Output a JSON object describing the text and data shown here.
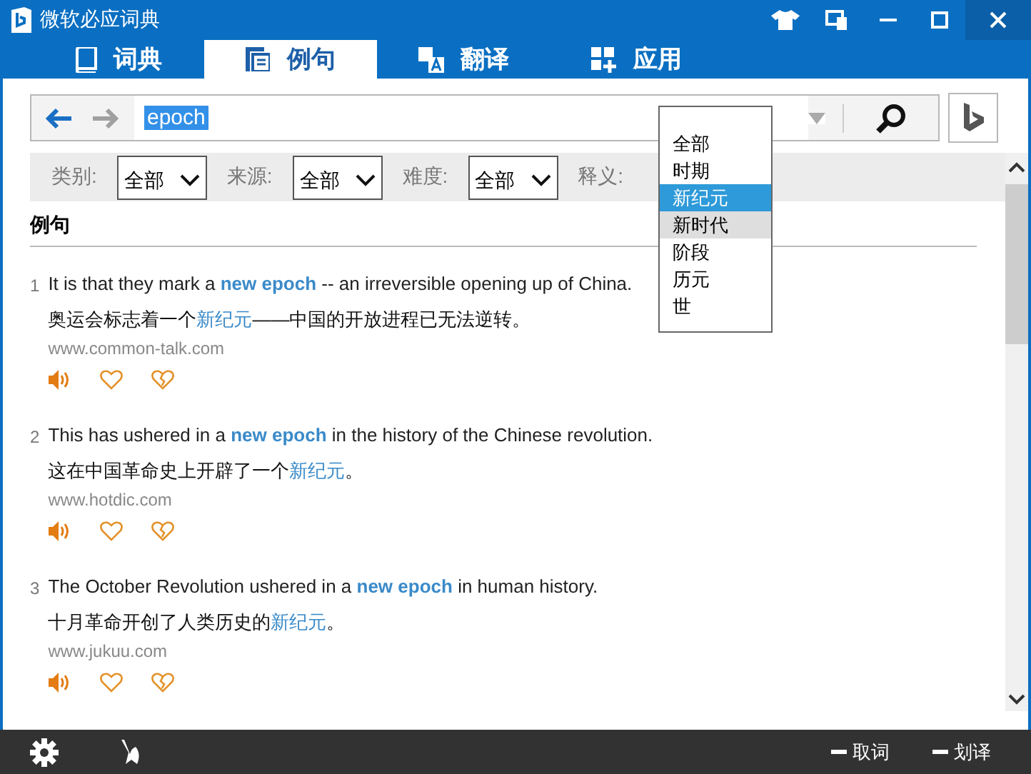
{
  "window": {
    "title": "微软必应词典"
  },
  "tabs": [
    {
      "label": "词典",
      "selected": false
    },
    {
      "label": "例句",
      "selected": true
    },
    {
      "label": "翻译",
      "selected": false
    },
    {
      "label": "应用",
      "selected": false
    }
  ],
  "search": {
    "value": "epoch",
    "text_selected": true
  },
  "filters": [
    {
      "label": "类别:",
      "value": "全部"
    },
    {
      "label": "来源:",
      "value": "全部"
    },
    {
      "label": "难度:",
      "value": "全部"
    },
    {
      "label": "释义:"
    }
  ],
  "dropdown": [
    {
      "label": "全部",
      "selected": false,
      "hovered": false
    },
    {
      "label": "时期",
      "selected": false,
      "hovered": false
    },
    {
      "label": "新纪元",
      "selected": true,
      "hovered": false
    },
    {
      "label": "新时代",
      "selected": false,
      "hovered": true
    },
    {
      "label": "阶段",
      "selected": false,
      "hovered": false
    },
    {
      "label": "历元",
      "selected": false,
      "hovered": false
    },
    {
      "label": "世",
      "selected": false,
      "hovered": false
    }
  ],
  "section_title": "例句",
  "examples": [
    {
      "number": "1",
      "english": "It is that they mark a **new epoch** -- an irreversible opening up of China.",
      "chinese": "奥运会标志着一个**新纪元**——中国的开放进程已无法逆转。",
      "source": "www.common-talk.com"
    },
    {
      "number": "2",
      "english": "This has ushered in a **new epoch** in the history of the Chinese revolution.",
      "chinese": "这在中国革命史上开辟了一个**新纪元**。",
      "source": "www.hotdic.com"
    },
    {
      "number": "3",
      "english": "The October Revolution ushered in a **new epoch** in human history.",
      "chinese": "十月革命开创了人类历史的**新纪元**。",
      "source": "www.jukuu.com"
    }
  ],
  "bottom_toggles": [
    {
      "label": "取词",
      "on": false
    },
    {
      "label": "划译",
      "on": false
    }
  ]
}
